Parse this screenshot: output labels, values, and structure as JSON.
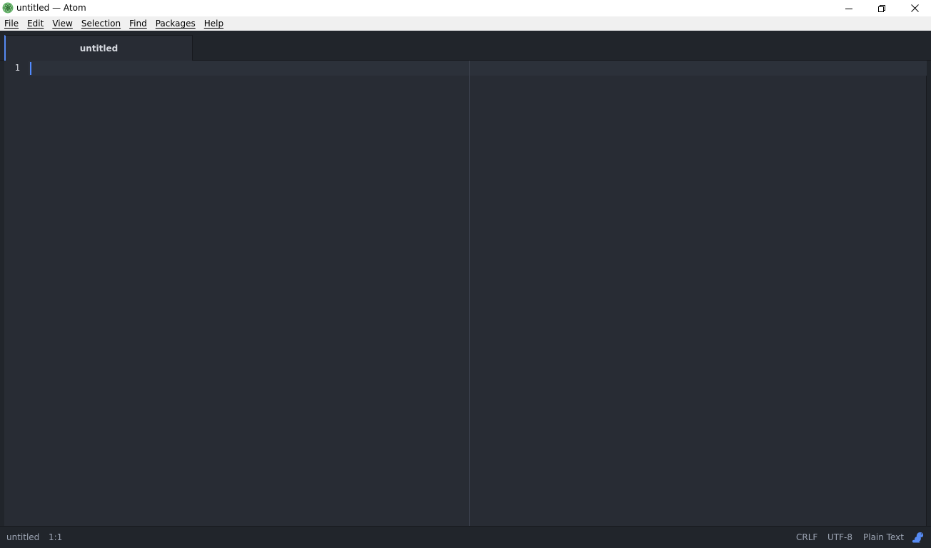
{
  "window": {
    "title": "untitled — Atom",
    "logo_icon": "atom-logo-icon",
    "controls": [
      "minimize-icon",
      "restore-icon",
      "close-icon"
    ]
  },
  "menubar": {
    "items": [
      {
        "label": "File"
      },
      {
        "label": "Edit"
      },
      {
        "label": "View"
      },
      {
        "label": "Selection"
      },
      {
        "label": "Find"
      },
      {
        "label": "Packages"
      },
      {
        "label": "Help"
      }
    ]
  },
  "tabs": [
    {
      "label": "untitled",
      "active": true
    }
  ],
  "editor": {
    "line_numbers": [
      "1"
    ],
    "content": ""
  },
  "statusbar": {
    "file_name": "untitled",
    "cursor_position": "1:1",
    "line_ending": "CRLF",
    "encoding": "UTF-8",
    "grammar": "Plain Text",
    "update_icon": "squirrel-icon"
  },
  "colors": {
    "accent": "#568af2",
    "editor_bg": "#282c34",
    "chrome_bg": "#21252b",
    "cursor": "#528bff",
    "status_text": "#9da5b4"
  }
}
